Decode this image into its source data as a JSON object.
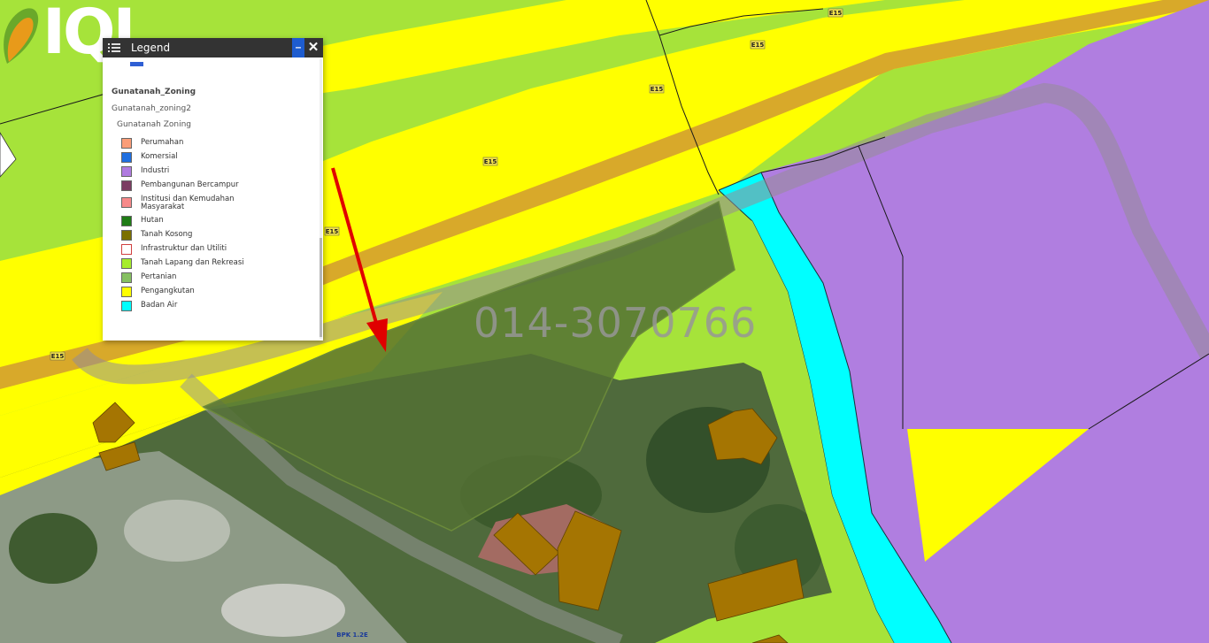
{
  "logo": {
    "text": "IQI"
  },
  "watermark": {
    "phone": "014-3070766"
  },
  "road_labels": {
    "e15_a": "E15",
    "e15_b": "E15",
    "e15_c": "E15",
    "e15_d": "E15",
    "e15_e": "E15",
    "e15_f": "E15",
    "bottom": "BPK 1.2E"
  },
  "legend": {
    "title": "Legend",
    "minimize_icon": "minimize-icon",
    "close_icon": "close-icon",
    "layer_name": "Gunatanah_Zoning",
    "sublayer": "Gunatanah_zoning2",
    "subsublayer": "Gunatanah Zoning",
    "items": [
      {
        "label": "Perumahan",
        "color": "#fa9d78"
      },
      {
        "label": "Komersial",
        "color": "#1f6fe0"
      },
      {
        "label": "Industri",
        "color": "#b07be0"
      },
      {
        "label": "Pembangunan Bercampur",
        "color": "#7b3d62"
      },
      {
        "label": "Institusi dan Kemudahan Masyarakat",
        "color": "#f78a8a"
      },
      {
        "label": "Hutan",
        "color": "#1f7c16"
      },
      {
        "label": "Tanah Kosong",
        "color": "#7b7000"
      },
      {
        "label": "Infrastruktur dan Utiliti",
        "color": "#ffffff"
      },
      {
        "label": "Tanah Lapang dan Rekreasi",
        "color": "#a6ed2c"
      },
      {
        "label": "Pertanian",
        "color": "#86c061"
      },
      {
        "label": "Pengangkutan",
        "color": "#ffff00"
      },
      {
        "label": "Badan Air",
        "color": "#00ffff"
      }
    ]
  },
  "colors": {
    "recreation_green": "#a6e33a",
    "transport_yellow": "#ffff00",
    "industry_purple": "#b07ee0",
    "water_cyan": "#00ffff",
    "building_brown": "#a57502",
    "highlight_red": "#e00000"
  }
}
